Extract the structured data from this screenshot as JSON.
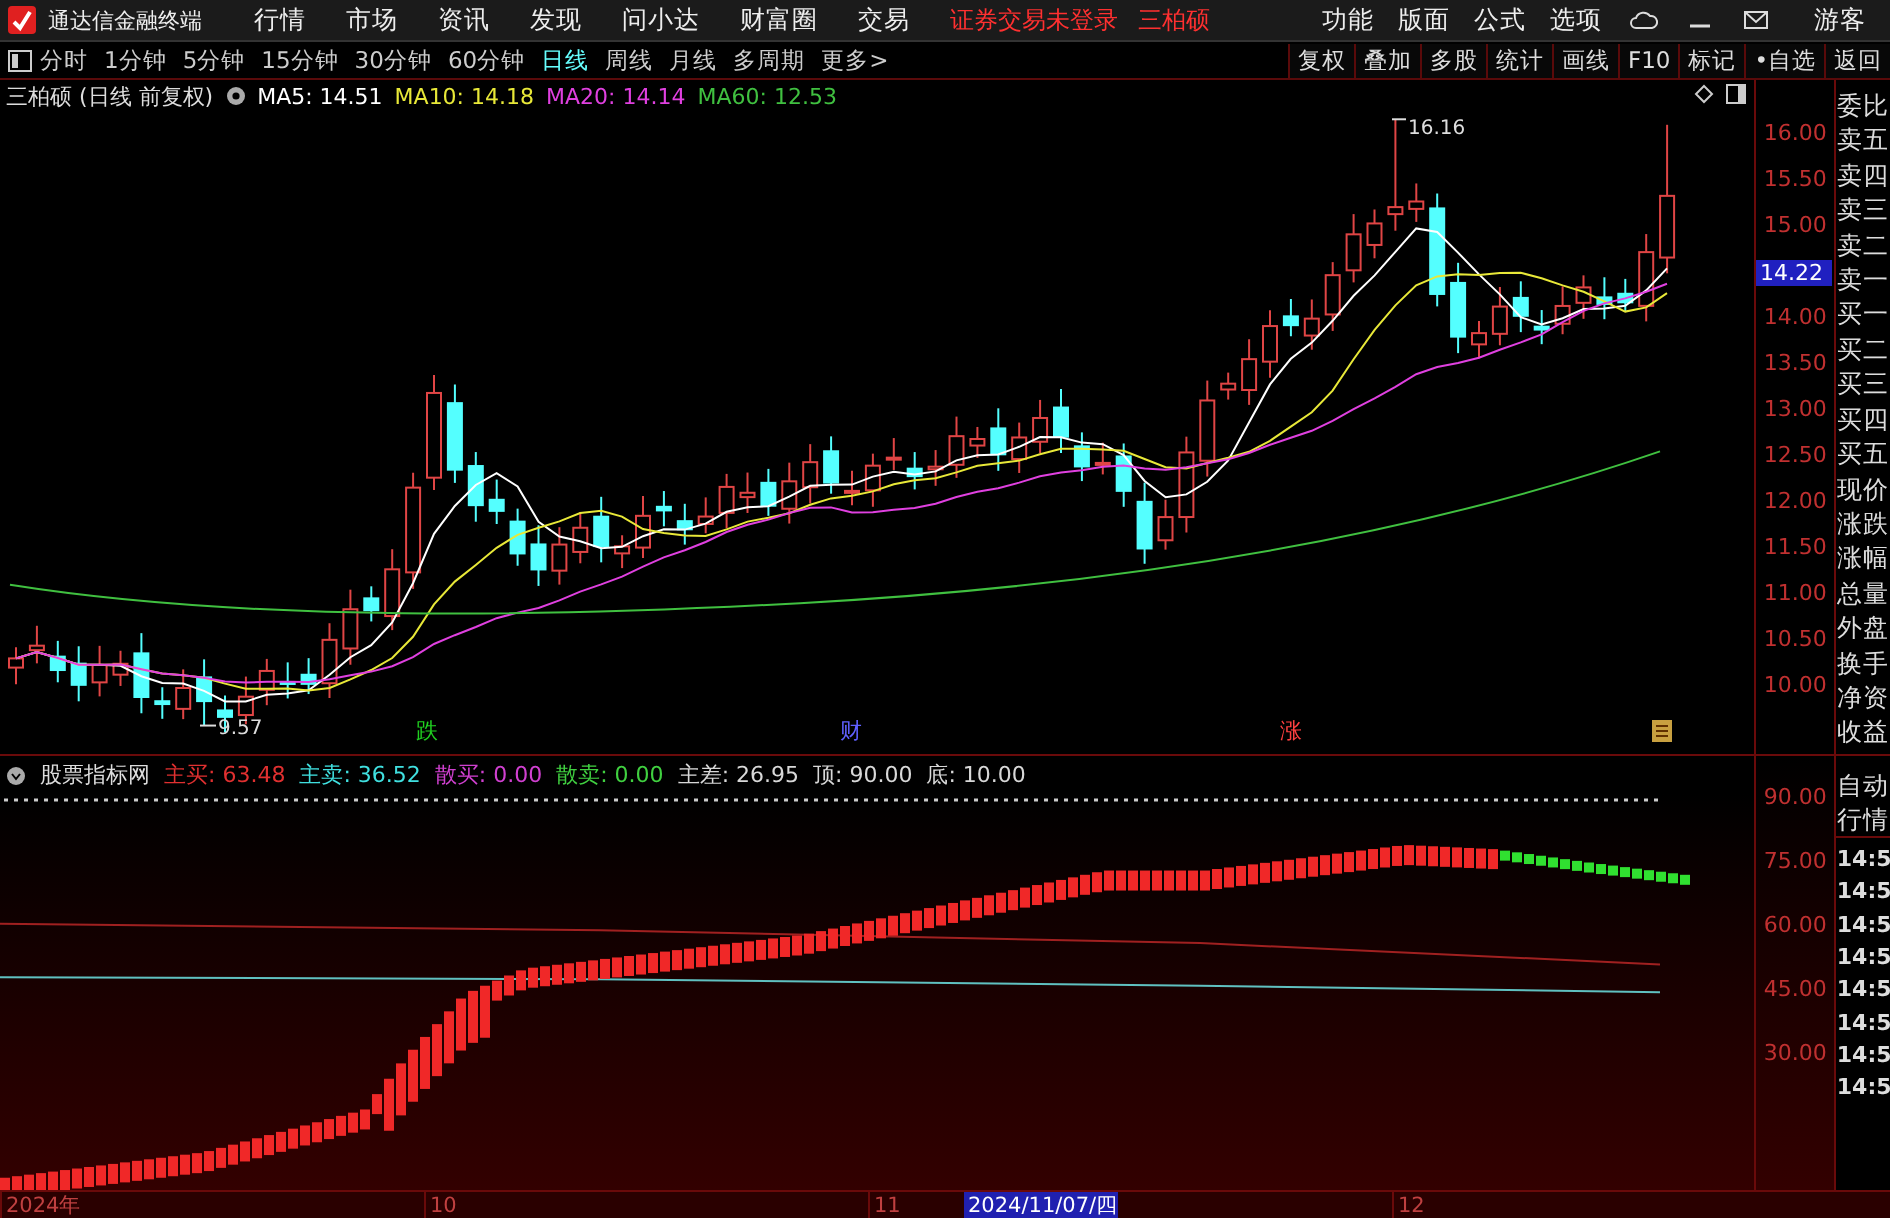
{
  "app": {
    "title": "通达信金融终端"
  },
  "menu": [
    "行情",
    "市场",
    "资讯",
    "发现",
    "问小达",
    "财富圈",
    "交易"
  ],
  "login_status": "证券交易未登录",
  "stock_name": "三柏硕",
  "top_right_menu": [
    "功能",
    "版面",
    "公式",
    "选项"
  ],
  "user": "游客",
  "periods": [
    {
      "label": "分时",
      "selected": false
    },
    {
      "label": "1分钟",
      "selected": false
    },
    {
      "label": "5分钟",
      "selected": false
    },
    {
      "label": "15分钟",
      "selected": false
    },
    {
      "label": "30分钟",
      "selected": false
    },
    {
      "label": "60分钟",
      "selected": false
    },
    {
      "label": "日线",
      "selected": true
    },
    {
      "label": "周线",
      "selected": false
    },
    {
      "label": "月线",
      "selected": false
    },
    {
      "label": "多周期",
      "selected": false
    },
    {
      "label": "更多>",
      "selected": false
    }
  ],
  "tools": [
    "复权",
    "叠加",
    "多股",
    "统计",
    "画线",
    "F10",
    "标记",
    "•自选",
    "返回"
  ],
  "main_chart": {
    "title": "三柏硕 (日线 前复权)",
    "ma": [
      {
        "label": "MA5: 14.51",
        "color": "#ffffff"
      },
      {
        "label": "MA10: 14.18",
        "color": "#e8e838"
      },
      {
        "label": "MA20: 14.14",
        "color": "#e040e0"
      },
      {
        "label": "MA60: 12.53",
        "color": "#40c040"
      }
    ],
    "high_label": "16.16",
    "low_label": "9.57",
    "price_ticks": [
      "16.00",
      "15.50",
      "15.00",
      "14.00",
      "13.50",
      "13.00",
      "12.50",
      "12.00",
      "11.50",
      "11.00",
      "10.50",
      "10.00"
    ],
    "current_price": "14.22",
    "event_marks": [
      "跌",
      "财",
      "涨"
    ]
  },
  "quote_fields": [
    "委比",
    "卖五",
    "卖四",
    "卖三",
    "卖二",
    "卖一",
    "买一",
    "买二",
    "买三",
    "买四",
    "买五",
    "现价",
    "涨跌",
    "涨幅",
    "总量",
    "外盘",
    "换手",
    "净资",
    "收益"
  ],
  "indicator": {
    "title": "股票指标网",
    "values": [
      {
        "label": "主买: 63.48",
        "color": "#e03030"
      },
      {
        "label": "主卖: 36.52",
        "color": "#40e0e0"
      },
      {
        "label": "散买: 0.00",
        "color": "#d040d0"
      },
      {
        "label": "散卖: 0.00",
        "color": "#40d040"
      },
      {
        "label": "主差: 26.95",
        "color": "#d8d8d8"
      },
      {
        "label": "顶: 90.00",
        "color": "#d8d8d8"
      },
      {
        "label": "底: 10.00",
        "color": "#d8d8d8"
      }
    ],
    "ticks": [
      "90.00",
      "75.00",
      "60.00",
      "45.00",
      "30.00"
    ]
  },
  "ticker": {
    "mode": "自动行情",
    "times": [
      "14:5",
      "14:5",
      "14:5",
      "14:5",
      "14:5",
      "14:5",
      "14:5",
      "14:5"
    ]
  },
  "date_axis": [
    {
      "label": "2024年",
      "selected": false
    },
    {
      "label": "10",
      "selected": false
    },
    {
      "label": "11",
      "selected": false
    },
    {
      "label": "2024/11/07/四",
      "selected": true
    },
    {
      "label": "12",
      "selected": false
    }
  ]
}
